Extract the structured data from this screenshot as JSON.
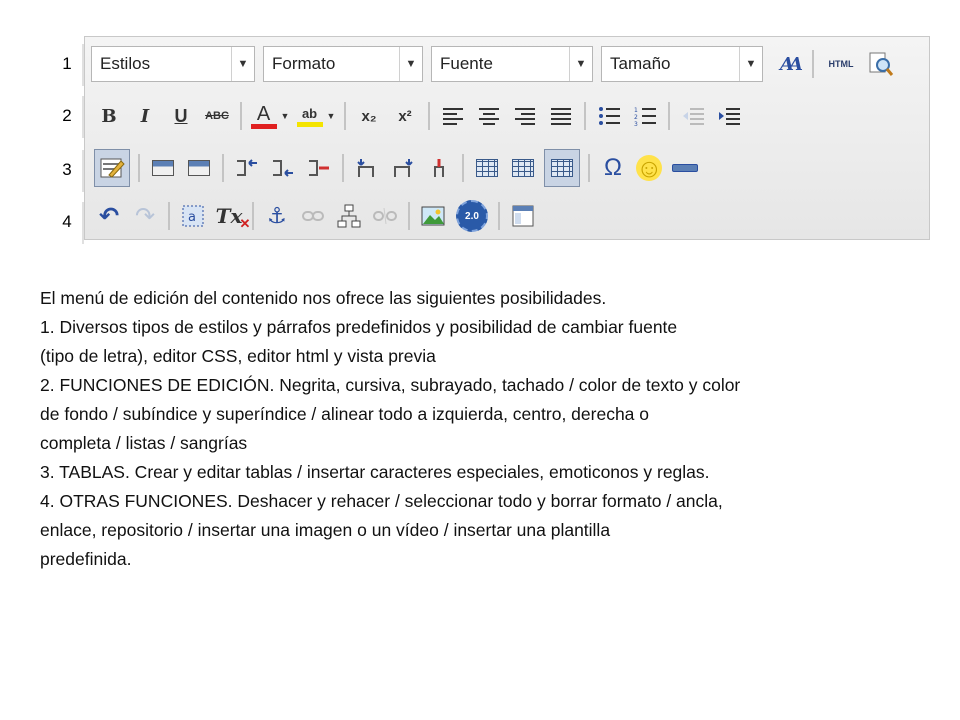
{
  "row_numbers": [
    "1",
    "2",
    "3",
    "4"
  ],
  "toolbar": {
    "row1": {
      "combos": [
        {
          "name": "styles-combo",
          "label": "Estilos"
        },
        {
          "name": "format-combo",
          "label": "Formato"
        },
        {
          "name": "font-combo",
          "label": "Fuente"
        },
        {
          "name": "size-combo",
          "label": "Tamaño"
        }
      ],
      "css_icon_label": "AA",
      "html_label": "HTML"
    },
    "row2": {
      "bold": "B",
      "italic": "I",
      "underline": "U",
      "strike": "ABC",
      "text_color": "A",
      "bg_color": "ab",
      "subscript": "x₂",
      "superscript": "x²",
      "text_color_hex": "#e02020",
      "bg_color_hex": "#f4e400"
    },
    "row3": {
      "special_chars": "Ω",
      "emoticon": "☺"
    },
    "row4": {
      "undo": "↶",
      "redo": "↷",
      "clear_format": "Tx",
      "anchor": "⚓",
      "video_badge": "2.0"
    }
  },
  "description": {
    "lines": [
      "El menú de edición del contenido nos ofrece las siguientes posibilidades.",
      "1. Diversos tipos de estilos y párrafos predefinidos y posibilidad de cambiar fuente",
      "(tipo de letra), editor CSS, editor html y vista previa",
      "2. FUNCIONES DE EDICIÓN. Negrita, cursiva, subrayado, tachado / color de texto y color",
      "de fondo / subíndice y superíndice / alinear todo a izquierda, centro, derecha o",
      "completa / listas / sangrías",
      "3. TABLAS. Crear y editar tablas / insertar caracteres especiales, emoticonos y reglas.",
      "4. OTRAS FUNCIONES. Deshacer y rehacer / seleccionar todo y borrar formato / ancla,",
      "enlace, repositorio / insertar una imagen o un vídeo / insertar una plantilla",
      "predefinida."
    ]
  }
}
